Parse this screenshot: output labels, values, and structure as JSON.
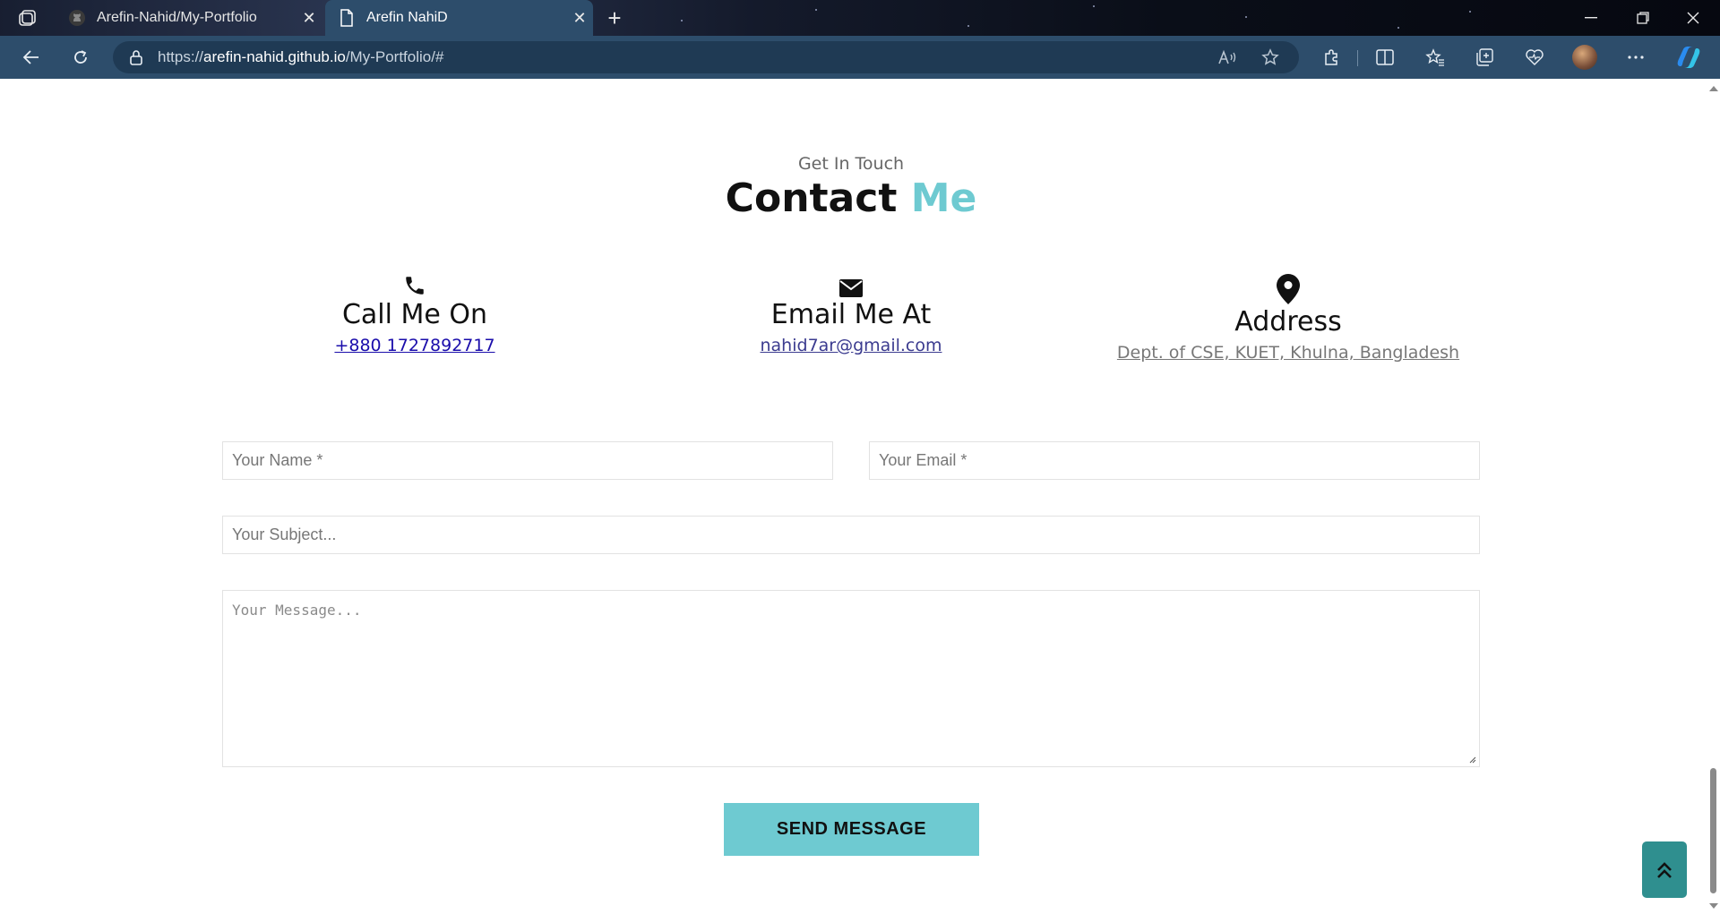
{
  "browser": {
    "tabs": [
      {
        "title": "Arefin-Nahid/My-Portfolio",
        "favicon": "github-icon",
        "active": false
      },
      {
        "title": "Arefin NahiD",
        "favicon": "document-icon",
        "active": true
      }
    ],
    "address": {
      "prefix": "https://",
      "host": "arefin-nahid.github.io",
      "path": "/My-Portfolio/#"
    }
  },
  "contact": {
    "subtitle": "Get In Touch",
    "title_main": "Contact",
    "title_accent": "Me",
    "accent_color": "#6ecad1",
    "items": [
      {
        "icon": "phone-icon",
        "label": "Call Me On",
        "value": "+880 1727892717",
        "link_color": "#1a0dab"
      },
      {
        "icon": "envelope-icon",
        "label": "Email Me At",
        "value": "nahid7ar@gmail.com",
        "link_color": "#3b3b8f"
      },
      {
        "icon": "map-pin-icon",
        "label": "Address",
        "value": "Dept. of CSE, KUET, Khulna, Bangladesh",
        "link_color": "#777777"
      }
    ],
    "form": {
      "name_placeholder": "Your Name *",
      "email_placeholder": "Your Email *",
      "subject_placeholder": "Your Subject...",
      "message_placeholder": "Your Message...",
      "submit_label": "SEND MESSAGE"
    }
  },
  "back_to_top_icon": "double-chevron-up-icon"
}
